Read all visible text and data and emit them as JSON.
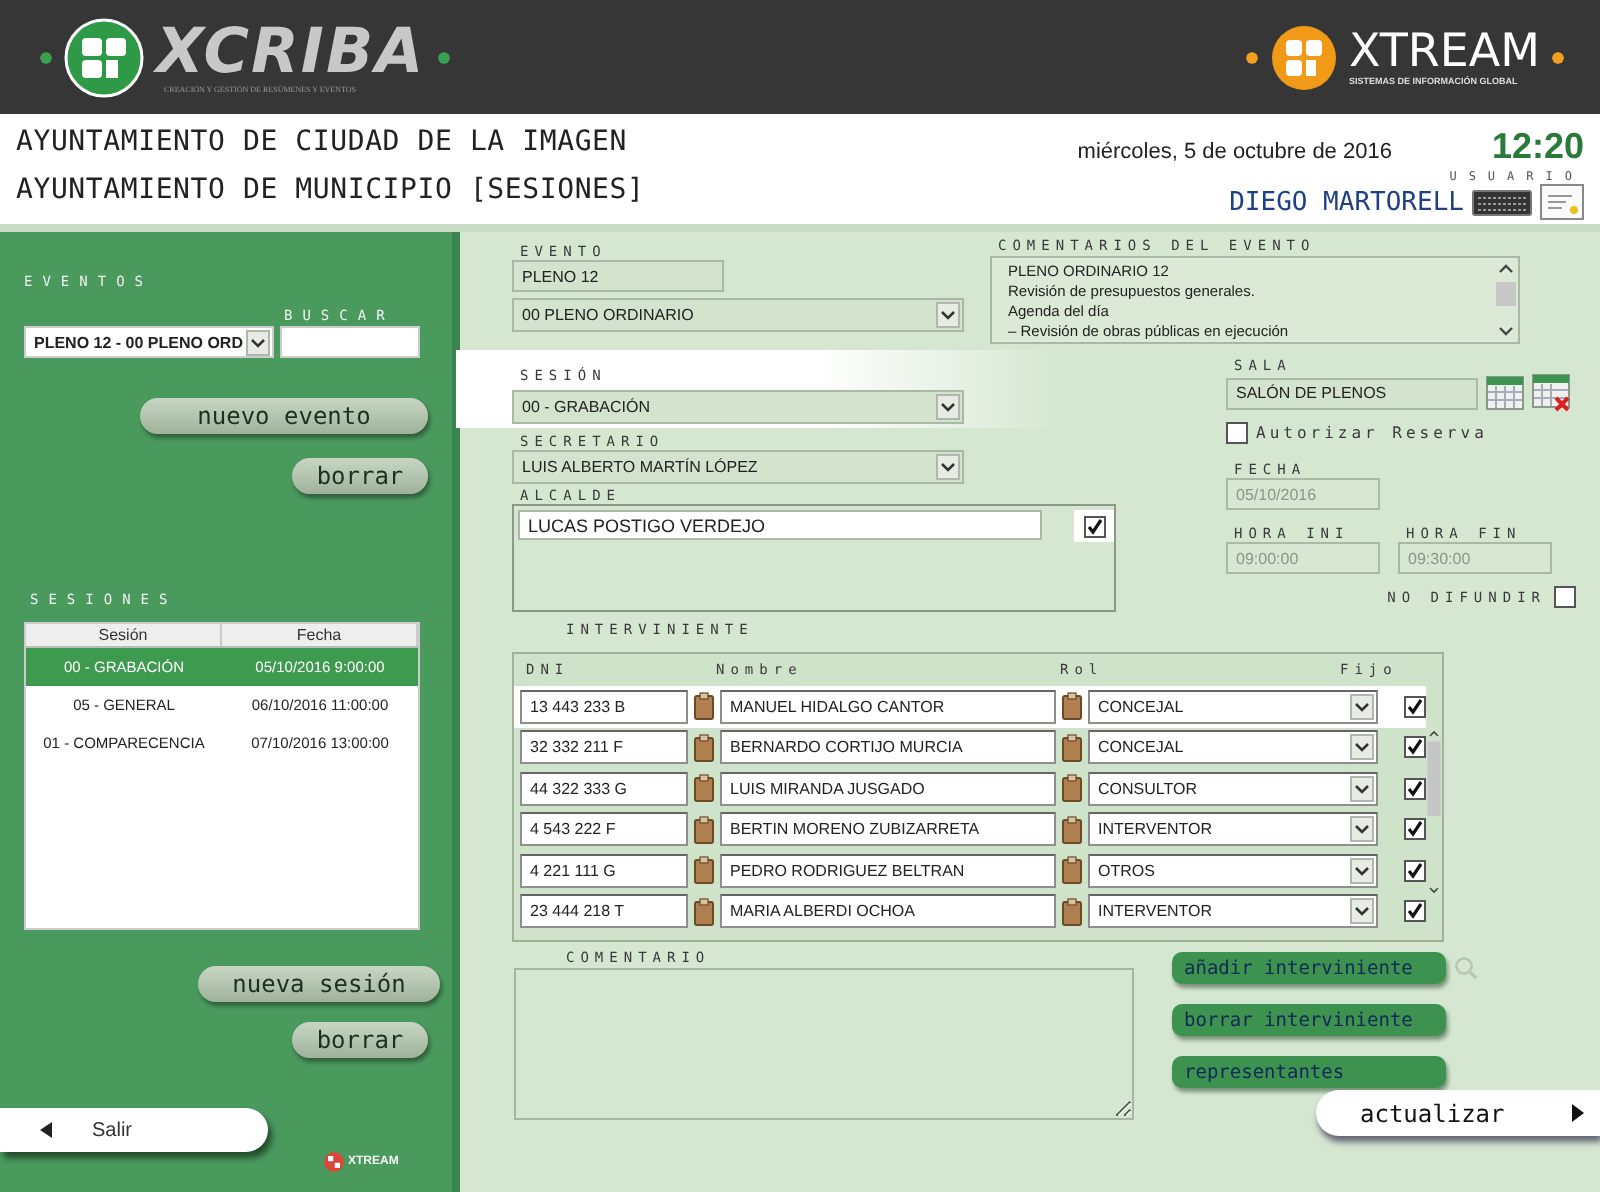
{
  "header": {
    "brand": "XCRIBA",
    "brand_tagline": "CREACIÓN Y GESTIÓN DE RESÚMENES Y EVENTOS",
    "partner": "XTREAM",
    "partner_tagline": "SISTEMAS DE INFORMACIÓN GLOBAL"
  },
  "info_bar": {
    "title": "AYUNTAMIENTO DE CIUDAD DE LA IMAGEN",
    "subtitle": "AYUNTAMIENTO DE MUNICIPIO [SESIONES]",
    "date": "miércoles, 5 de octubre de 2016",
    "time": "12:20",
    "user_label": "USUARIO",
    "user": "DIEGO MARTORELL"
  },
  "sidebar": {
    "events_label": "EVENTOS",
    "event_select": "PLENO 12 - 00 PLENO ORD",
    "search_label": "BUSCAR",
    "event_buttons": [
      "nuevo evento",
      "borrar"
    ],
    "sessions_label": "SESIONES",
    "sessions": {
      "columns": [
        "Sesión",
        "Fecha"
      ],
      "rows": [
        {
          "cells": [
            "00 - GRABACIÓN",
            "05/10/2016 9:00:00"
          ],
          "selected": true
        },
        {
          "cells": [
            "05 - GENERAL",
            "06/10/2016 11:00:00"
          ],
          "selected": false
        },
        {
          "cells": [
            "01 - COMPARECENCIA",
            "07/10/2016 13:00:00"
          ],
          "selected": false
        }
      ]
    },
    "session_buttons": [
      "nueva sesión",
      "borrar"
    ],
    "exit_button": "Salir",
    "footer_logo": "XTREAM"
  },
  "form": {
    "evento_label": "EVENTO",
    "evento": "PLENO 12",
    "evento_tipo": "00 PLENO ORDINARIO",
    "comments_label": "COMENTARIOS DEL EVENTO",
    "comments": [
      "PLENO ORDINARIO 12",
      "Revisión de presupuestos generales.",
      "Agenda del día",
      "– Revisión de obras públicas en ejecución"
    ],
    "sesion_label": "SESIÓN",
    "sesion": "00 - GRABACIÓN",
    "secretario_label": "SECRETARIO",
    "secretario": "LUIS ALBERTO MARTÍN LÓPEZ",
    "alcalde_label": "ALCALDE",
    "alcalde": "LUCAS POSTIGO VERDEJO",
    "alcalde_checked": true,
    "sala_label": "SALA",
    "sala": "SALÓN DE PLENOS",
    "autorizar": {
      "label": "Autorizar Reserva",
      "checked": false
    },
    "fecha_label": "FECHA",
    "fecha": "05/10/2016",
    "hora_ini_label": "HORA INI",
    "hora_ini": "09:00:00",
    "hora_fin_label": "HORA FIN",
    "hora_fin": "09:30:00",
    "no_difundir": {
      "label": "NO DIFUNDIR",
      "checked": false
    },
    "intervinientes": {
      "label": "INTERVINIENTE",
      "columns": [
        "DNI",
        "Nombre",
        "Rol",
        "Fijo"
      ],
      "rows": [
        {
          "dni": "13 443 233 B",
          "nombre": "MANUEL HIDALGO CANTOR",
          "rol": "CONCEJAL",
          "fijo": true,
          "selected": true
        },
        {
          "dni": "32 332 211 F",
          "nombre": "BERNARDO CORTIJO MURCIA",
          "rol": "CONCEJAL",
          "fijo": true,
          "selected": false
        },
        {
          "dni": "44 322 333 G",
          "nombre": "LUIS MIRANDA JUSGADO",
          "rol": "CONSULTOR",
          "fijo": true,
          "selected": false
        },
        {
          "dni": "4 543 222 F",
          "nombre": "BERTIN MORENO ZUBIZARRETA",
          "rol": "INTERVENTOR",
          "fijo": true,
          "selected": false
        },
        {
          "dni": "4 221 111 G",
          "nombre": "PEDRO RODRIGUEZ BELTRAN",
          "rol": "OTROS",
          "fijo": true,
          "selected": false
        },
        {
          "dni": "23 444 218 T",
          "nombre": "MARIA ALBERDI OCHOA",
          "rol": "INTERVENTOR",
          "fijo": true,
          "selected": false
        }
      ]
    },
    "comentario_label": "COMENTARIO",
    "actions": [
      "añadir interviniente",
      "borrar interviniente",
      "representantes"
    ],
    "update_button": "actualizar"
  }
}
